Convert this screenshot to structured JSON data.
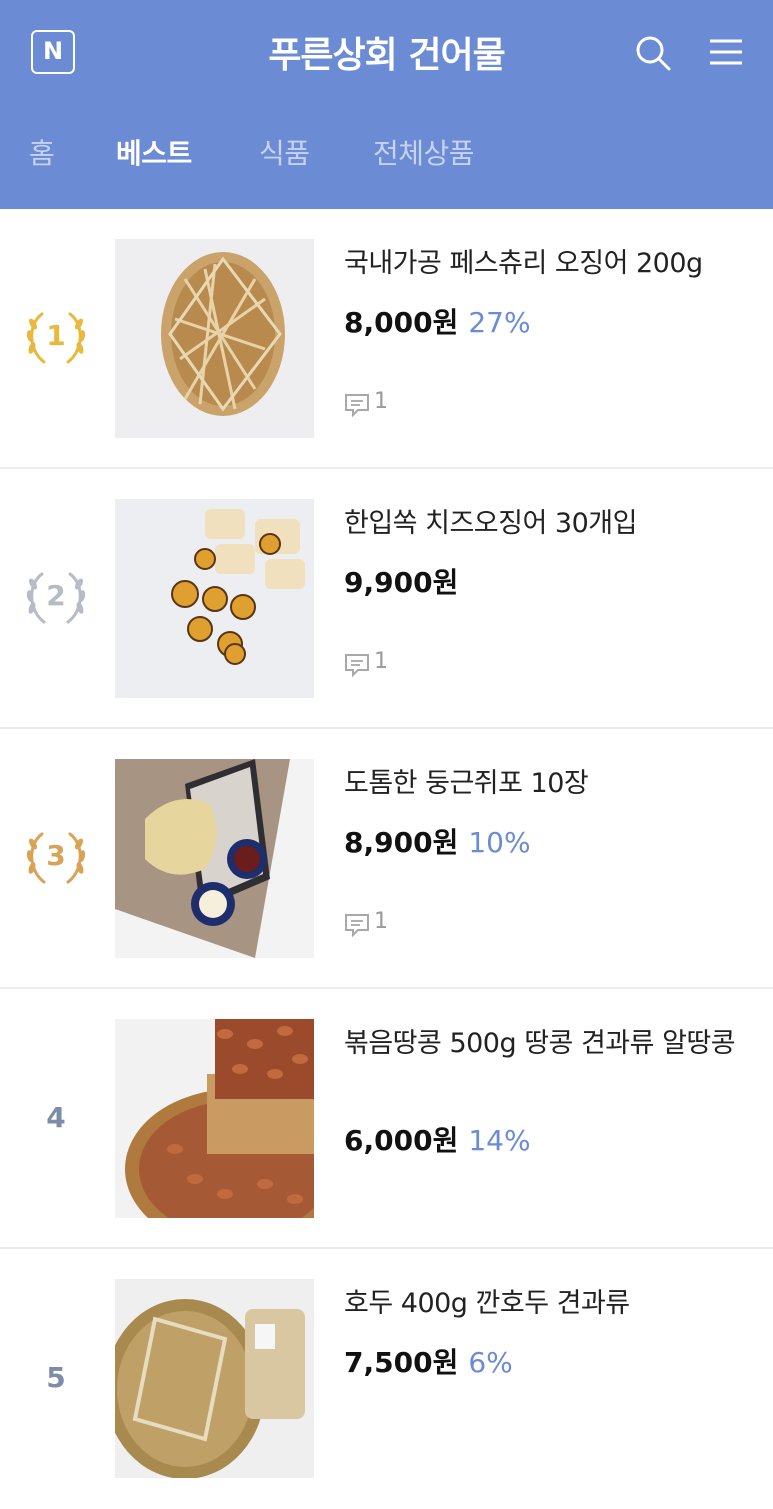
{
  "header": {
    "logo_letter": "N",
    "title": "푸른상회 건어물",
    "bg_color": "#6b8bd4"
  },
  "tabs": [
    {
      "label": "홈",
      "active": false
    },
    {
      "label": "베스트",
      "active": true
    },
    {
      "label": "식품",
      "active": false
    },
    {
      "label": "전체상품",
      "active": false
    }
  ],
  "products": [
    {
      "rank": "1",
      "medal": "gold",
      "name": "국내가공 페스츄리 오징어 200g",
      "price": "8,000원",
      "discount": "27%",
      "reviews": "1"
    },
    {
      "rank": "2",
      "medal": "silver",
      "name": "한입쏙 치즈오징어 30개입",
      "price": "9,900원",
      "discount": "",
      "reviews": "1"
    },
    {
      "rank": "3",
      "medal": "bronze",
      "name": "도톰한 둥근쥐포 10장",
      "price": "8,900원",
      "discount": "10%",
      "reviews": "1"
    },
    {
      "rank": "4",
      "medal": "none",
      "name": "볶음땅콩 500g 땅콩 견과류 알땅콩",
      "price": "6,000원",
      "discount": "14%",
      "reviews": ""
    },
    {
      "rank": "5",
      "medal": "none",
      "name": "호두 400g 깐호두 견과류",
      "price": "7,500원",
      "discount": "6%",
      "reviews": ""
    }
  ],
  "colors": {
    "accent": "#6b8bd4",
    "gold": "#e8b93c",
    "silver": "#b6bcc6",
    "bronze": "#d9a355",
    "rank_plain": "#7d8da8"
  },
  "icons": {
    "logo": "naver-n-icon",
    "search": "search-icon",
    "menu": "hamburger-menu-icon",
    "review": "comment-icon",
    "medal": "laurel-wreath-icon"
  }
}
